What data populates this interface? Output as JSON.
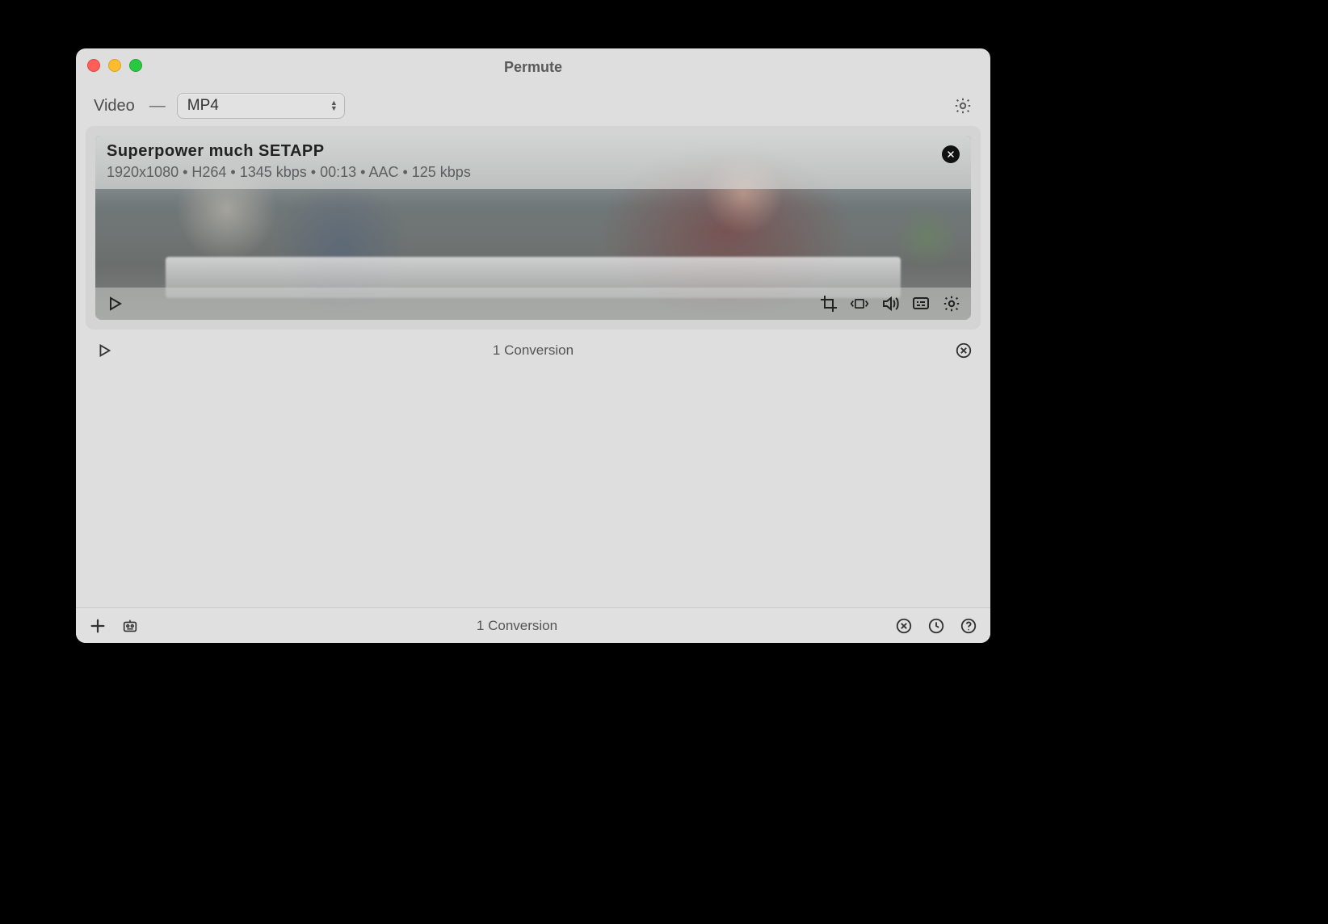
{
  "window": {
    "title": "Permute"
  },
  "toolbar": {
    "category_label": "Video",
    "dash": "—",
    "format_selected": "MP4"
  },
  "card": {
    "title": "Superpower much  SETAPP",
    "meta": "1920x1080 • H264 • 1345 kbps • 00:13 • AAC • 125 kbps"
  },
  "status": {
    "text": "1 Conversion"
  },
  "bottom": {
    "text": "1 Conversion"
  }
}
